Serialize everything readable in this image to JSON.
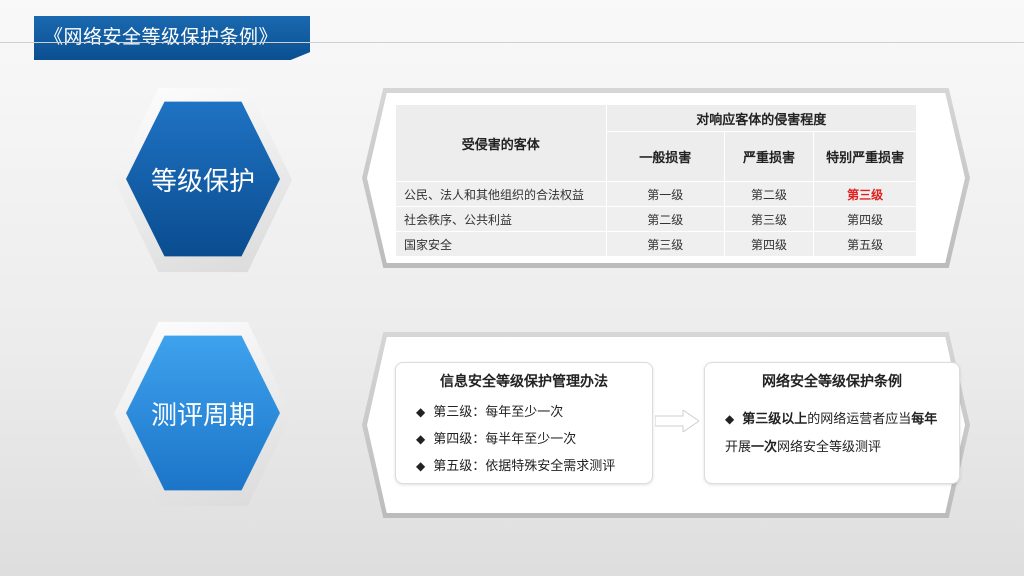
{
  "header": {
    "title": "《网络安全等级保护条例》"
  },
  "badges": {
    "level_protection": "等级保护",
    "assessment_cycle": "测评周期"
  },
  "table": {
    "object_header": "受侵害的客体",
    "degree_header": "对响应客体的侵害程度",
    "columns": [
      "一般损害",
      "严重损害",
      "特别严重损害"
    ],
    "rows": [
      {
        "object": "公民、法人和其他组织的合法权益",
        "cells": [
          "第一级",
          "第二级",
          "第三级"
        ],
        "highlight_index": 2
      },
      {
        "object": "社会秩序、公共利益",
        "cells": [
          "第二级",
          "第三级",
          "第四级"
        ]
      },
      {
        "object": "国家安全",
        "cells": [
          "第三级",
          "第四级",
          "第五级"
        ]
      }
    ],
    "highlight_color": "#e21f1f"
  },
  "measures": {
    "title": "信息安全等级保护管理办法",
    "items": [
      "第三级：每年至少一次",
      "第四级：每半年至少一次",
      "第五级：依据特殊安全需求测评"
    ]
  },
  "regulation": {
    "title": "网络安全等级保护条例",
    "part1_bold": "第三级以上",
    "part2": "的网络运营者应当",
    "part3_bold": "每年",
    "part4": "开展",
    "part5_bold": "一次",
    "part6": "网络安全等级测评"
  },
  "colors": {
    "brand_blue": "#0b4f91",
    "light_blue": "#2b8be0"
  }
}
